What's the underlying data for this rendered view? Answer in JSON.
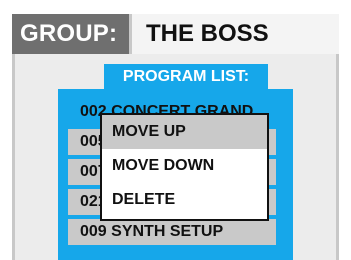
{
  "header": {
    "group_label": "GROUP:",
    "group_name": "THE BOSS"
  },
  "program_list": {
    "title": "PROGRAM LIST:",
    "items": [
      {
        "label": "002 CONCERT GRAND",
        "selected": true
      },
      {
        "label": "005",
        "selected": false
      },
      {
        "label": "007",
        "selected": false
      },
      {
        "label": "021",
        "selected": false
      },
      {
        "label": "009 SYNTH SETUP",
        "selected": false
      }
    ]
  },
  "context_menu": {
    "items": [
      {
        "label": "MOVE UP",
        "highlighted": true
      },
      {
        "label": "MOVE DOWN",
        "highlighted": false
      },
      {
        "label": "DELETE",
        "highlighted": false
      }
    ]
  },
  "colors": {
    "accent": "#16a7ea",
    "header_bg": "#6f6f6f",
    "row_bg": "#c9c9c9"
  }
}
